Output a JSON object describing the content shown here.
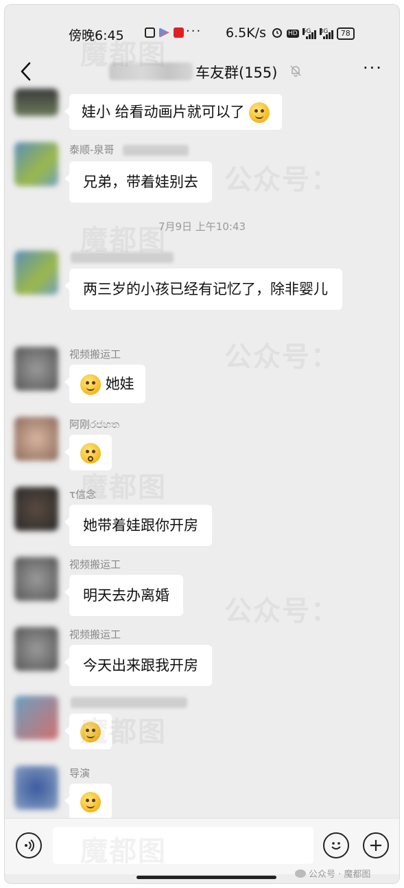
{
  "status_bar": {
    "time": "傍晚6:45",
    "more": "···",
    "net_speed": "6.5K/s",
    "hd": "HD",
    "sig1_label": "5G",
    "sig2_label": "3G",
    "battery": "78"
  },
  "nav": {
    "title": "车友群(155)",
    "more": "···"
  },
  "timestamp": "7月9日 上午10:43",
  "messages": [
    {
      "sender": "",
      "text": "娃小 给看动画片就可以了",
      "emoji": "thinking-face"
    },
    {
      "sender": "泰顺-泉哥",
      "text": "兄弟，带着娃别去"
    },
    {
      "sender": "",
      "text": "两三岁的小孩已经有记忆了，除非婴儿"
    },
    {
      "sender": "视频搬运工",
      "text": "她娃",
      "emoji": "crying-laughing-face"
    },
    {
      "sender": "阿刚ර෪හත",
      "text": "",
      "emoji": "shocked-face"
    },
    {
      "sender": "τ信念",
      "text": "她带着娃跟你开房"
    },
    {
      "sender": "视频搬运工",
      "text": "明天去办离婚"
    },
    {
      "sender": "视频搬运工",
      "text": "今天出来跟我开房"
    },
    {
      "sender": "",
      "text": "",
      "emoji": "sweat-smile-face"
    },
    {
      "sender": "导演",
      "text": "",
      "emoji": "sweat-smile-face"
    }
  ],
  "input": {
    "placeholder": ""
  },
  "watermark": {
    "text": "魔都图",
    "text2": "公众号：",
    "footer": "公众号 · 魔都图"
  },
  "icons": {
    "back": "chevron-left-icon",
    "mute": "bell-off-icon",
    "voice": "voice-icon",
    "emoji": "smile-icon",
    "plus": "plus-icon"
  }
}
